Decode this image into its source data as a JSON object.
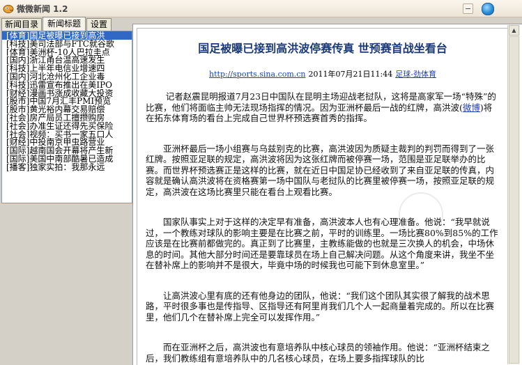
{
  "window": {
    "title": "微微新闻  1.2"
  },
  "tabs": [
    {
      "label": "新闻目录"
    },
    {
      "label": "新闻标题"
    },
    {
      "label": "设置"
    }
  ],
  "news_list": [
    "[体育]国足被曝已接到高洪",
    "[科技]美司法部与FTC就谷歌",
    "[体育]美洲杯-10人巴拉圭点",
    "[国内]浙江甬台温高速发生",
    "[科技]上半年电信业增速四",
    "[国内]河北沧州化工企业毒",
    "[科技]迅雷宣布推出在美IPO",
    "[财经]漫画书涨成收藏大投资",
    "[股市]中国7月汇丰PMI预览",
    "[股市]黄光裕内幕交易赔偿",
    "[社会]房产局员工擅攒购房",
    "[社会]办准生证还得先买保险",
    "[社会]视频：买书一家五口人",
    "[财经]中投南京甲虫路营业",
    "[国际]越南国会开幕将产生新",
    "[国际]美国中南部酷暑已造成",
    "[播客]独家实拍：我那永远"
  ],
  "article": {
    "title": "国足被曝已接到高洪波停赛传真  世预赛首战坐看台",
    "source_url": "http://sports.sina.com.cn",
    "date": "2011年07月21日11:44",
    "source_name": "足球-劲体育",
    "p1_a": "记者赵震昆明报道7月23日中国队在昆明主场迎战老挝队，这将是高家军一场“特殊”的比赛，他们将面临主帅无法现场指挥的情况。因为亚洲杯最后一战的红牌，高洪波(",
    "p1_link": "微博",
    "p1_b": ")将在拓东体育场的看台上完成自己世界杯预选赛首秀的指挥。",
    "p2": "亚洲杯最后一场小组赛与乌兹别克的比赛，高洪波因为质疑主裁判的判罚而得到了一张红牌。按照亚足联的规定，高洪波将因为这张红牌而被停赛一场，范围是亚足联举办的比赛。而世界杯预选赛正是这样的比赛，就在近日中国足协已经收到了来自亚足联的传真，内容就是确认高洪波将在资格赛第一场中国队与老挝队的比赛里被停赛一场，按照亚足联的规定，高洪波在这场比赛里只能在看台上观看比赛。",
    "p3": "国家队事实上对于这样的决定早有准备，高洪波本人也有心理准备。他说：“我早就说过，一个教练对球队的影响主要是在比赛之前，平时的训练里。一场比赛80%到85%的工作应该是在比赛前都做完的。真正到了比赛里，主教练能做的也就是三次换人的机会，中场休息的时间。其他大部分时间还是要靠球员在场上自己解决问题。从这个角度来讲，我坐不坐在替补席上的影响并不是很大，毕竟中场的时候我也可能下到休息室里。”",
    "p4": "让高洪波心里有底的还有他身边的团队，他说：“我们这个团队其实很了解我的战术思路，平时很多事也是传指导、区指导还有阿里肖我们几个人一起商量着完成的。所以在比赛里，他们几个在替补席上完全可以发挥作用。”",
    "p5": "而在亚洲杯之后，高洪波也有意培养队中核心球员的领袖作用。他说：“亚洲杯结束之后，我们教练组有意培养队中的几名核心球员，在场上要多指挥球队的比"
  }
}
